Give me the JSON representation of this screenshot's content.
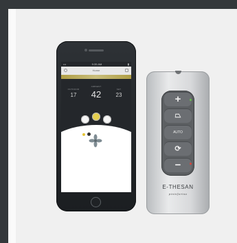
{
  "phone": {
    "status_left": "•••",
    "status_time": "9:35 AM",
    "status_right": "▮",
    "app_title": "Home",
    "temperatures": [
      {
        "label": "OUTDOOR",
        "value": "17"
      },
      {
        "label": "AMBIENT",
        "value": "42"
      },
      {
        "label": "SET",
        "value": "23"
      }
    ]
  },
  "remote": {
    "keys": [
      {
        "name": "plus",
        "label": "+"
      },
      {
        "name": "mode",
        "label": "⏢"
      },
      {
        "name": "auto",
        "label": "AUTO"
      },
      {
        "name": "swing",
        "label": "⟳"
      },
      {
        "name": "minus",
        "label": "−"
      }
    ],
    "brand": "E-THESAN",
    "brand_tag": "pininfarina"
  },
  "colors": {
    "accent": "#e5cf4d",
    "led_green": "#66c24a",
    "led_red": "#d8443c"
  }
}
